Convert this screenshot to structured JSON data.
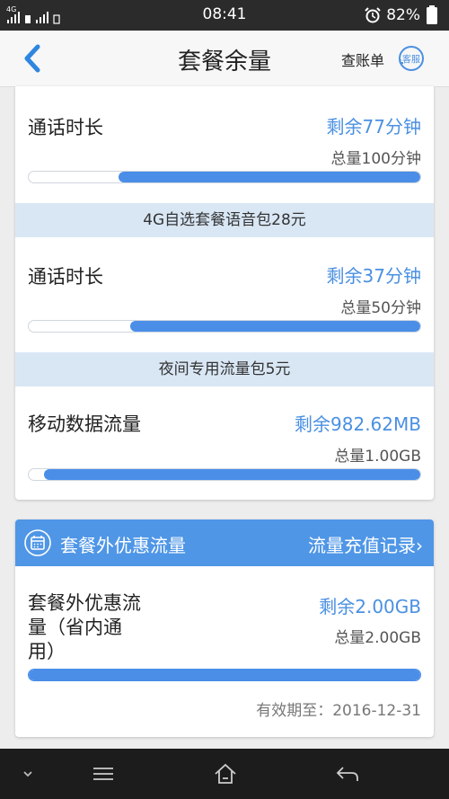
{
  "status": {
    "network": "4G",
    "time": "08:41",
    "battery": "82%",
    "alarm_icon": "alarm-clock-icon"
  },
  "header": {
    "back_icon": "chevron-left-icon",
    "title": "套餐余量",
    "bill_label": "查账单",
    "service_label": "客服"
  },
  "colors": {
    "accent": "#4a90e2",
    "band": "#d9e7f5",
    "bar": "#4a8ee8"
  },
  "package_items": [
    {
      "name": "通话时长",
      "remaining": "剩余77分钟",
      "total": "总量100分钟",
      "ratio": 0.77
    },
    {
      "name": "通话时长",
      "remaining": "剩余37分钟",
      "total": "总量50分钟",
      "ratio": 0.74
    },
    {
      "name": "移动数据流量",
      "remaining": "剩余982.62MB",
      "total": "总量1.00GB",
      "ratio": 0.96
    }
  ],
  "package_bands": [
    "4G自选套餐语音包28元",
    "夜间专用流量包5元"
  ],
  "extra_section": {
    "calendar_icon": "calendar-icon",
    "title": "套餐外优惠流量",
    "records_link": "流量充值记录",
    "item_name": "套餐外优惠流量（省内通用）",
    "item_name_lines": [
      "套餐外优惠流",
      "量（省内通",
      "用）"
    ],
    "remaining": "剩余2.00GB",
    "total": "总量2.00GB",
    "ratio": 1.0,
    "expiry": "有效期至：2016-12-31"
  },
  "navbar": {
    "icons": [
      "chevron-down-icon",
      "menu-icon",
      "home-icon",
      "back-arrow-icon"
    ]
  }
}
